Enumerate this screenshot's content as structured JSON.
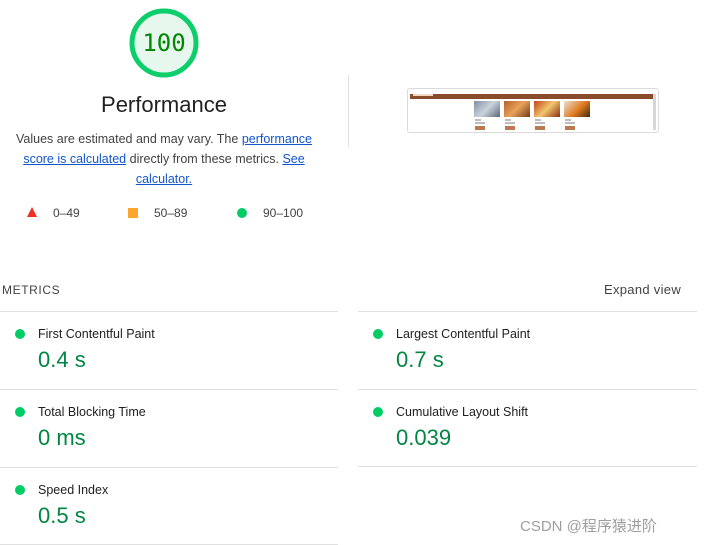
{
  "score": {
    "value": "100",
    "fraction": 1.0,
    "color": "#0cce6b"
  },
  "title": "Performance",
  "description": {
    "text_before": "Values are estimated and may vary. The ",
    "link1": "performance score is calculated",
    "text_mid": " directly from these metrics. ",
    "link2": "See calculator."
  },
  "legend": [
    {
      "icon": "fail-triangle-icon",
      "label": "0–49",
      "color": "#ee3322"
    },
    {
      "icon": "average-square-icon",
      "label": "50–89",
      "color": "#ffa42e"
    },
    {
      "icon": "pass-circle-icon",
      "label": "90–100",
      "color": "#00cc66"
    }
  ],
  "metrics_section": {
    "label": "METRICS",
    "expand_label": "Expand view"
  },
  "metrics": [
    {
      "title": "First Contentful Paint",
      "value": "0.4 s"
    },
    {
      "title": "Largest Contentful Paint",
      "value": "0.7 s"
    },
    {
      "title": "Total Blocking Time",
      "value": "0 ms"
    },
    {
      "title": "Cumulative Layout Shift",
      "value": "0.039"
    },
    {
      "title": "Speed Index",
      "value": "0.5 s"
    }
  ],
  "watermark": "CSDN @程序猿进阶"
}
